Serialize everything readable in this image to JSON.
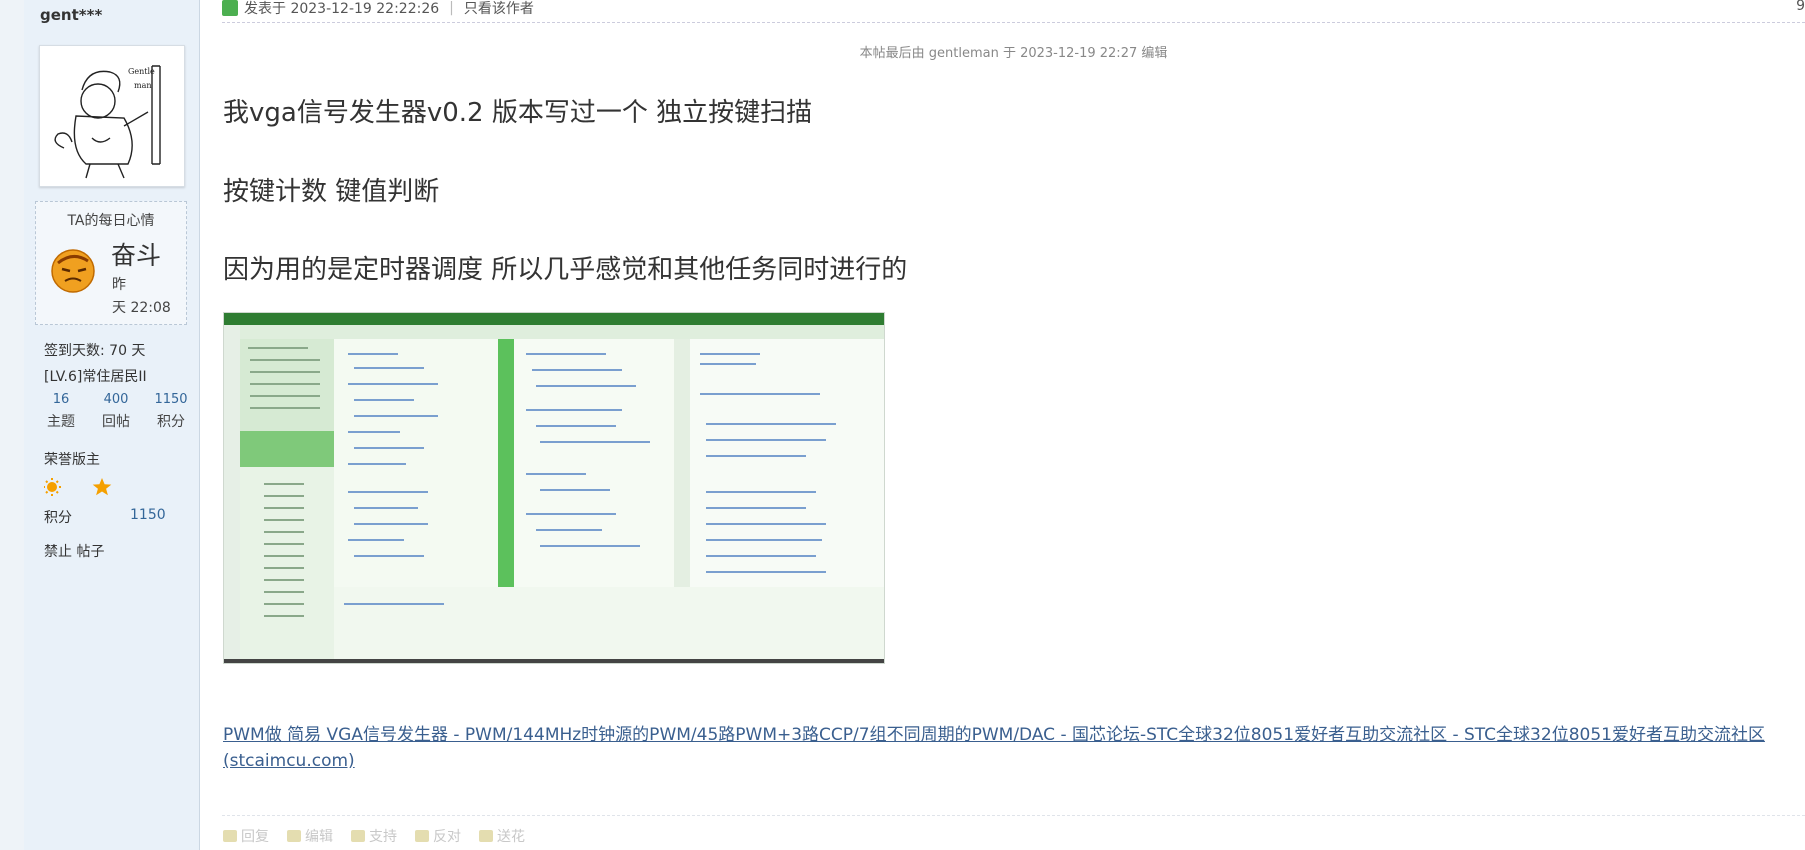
{
  "sidebar": {
    "username": "gent***",
    "mood": {
      "title": "TA的每日心情",
      "word": "奋斗",
      "time_line1": "昨",
      "time_line2": "天 22:08"
    },
    "signin": "签到天数: 70 天",
    "level": "[LV.6]常住居民II",
    "stats": [
      {
        "value": "16",
        "label": "主题"
      },
      {
        "value": "400",
        "label": "回帖"
      },
      {
        "value": "1150",
        "label": "积分"
      }
    ],
    "honor_title": "荣誉版主",
    "points_label": "积分",
    "points_value": "1150",
    "ban_text": "禁止 帖子"
  },
  "post": {
    "posted_at": "发表于 2023-12-19 22:22:26",
    "only_author": "只看该作者",
    "floor": "9",
    "edit_note": "本帖最后由 gentleman 于 2023-12-19 22:27 编辑",
    "lines": [
      "我vga信号发生器v0.2 版本写过一个  独立按键扫描",
      "按键计数    键值判断",
      "因为用的是定时器调度  所以几乎感觉和其他任务同时进行的"
    ],
    "link_text": "PWM做 简易 VGA信号发生器 - PWM/144MHz时钟源的PWM/45路PWM+3路CCP/7组不同周期的PWM/DAC - 国芯论坛-STC全球32位8051爱好者互助交流社区 - STC全球32位8051爱好者互助交流社区 (stcaimcu.com)"
  },
  "actions": [
    "回复",
    "编辑",
    "支持",
    "反对",
    "送花"
  ],
  "colors": {
    "sidebar_bg": "#e9f1f9",
    "link": "#3a5f8f",
    "stat_number": "#336699"
  }
}
